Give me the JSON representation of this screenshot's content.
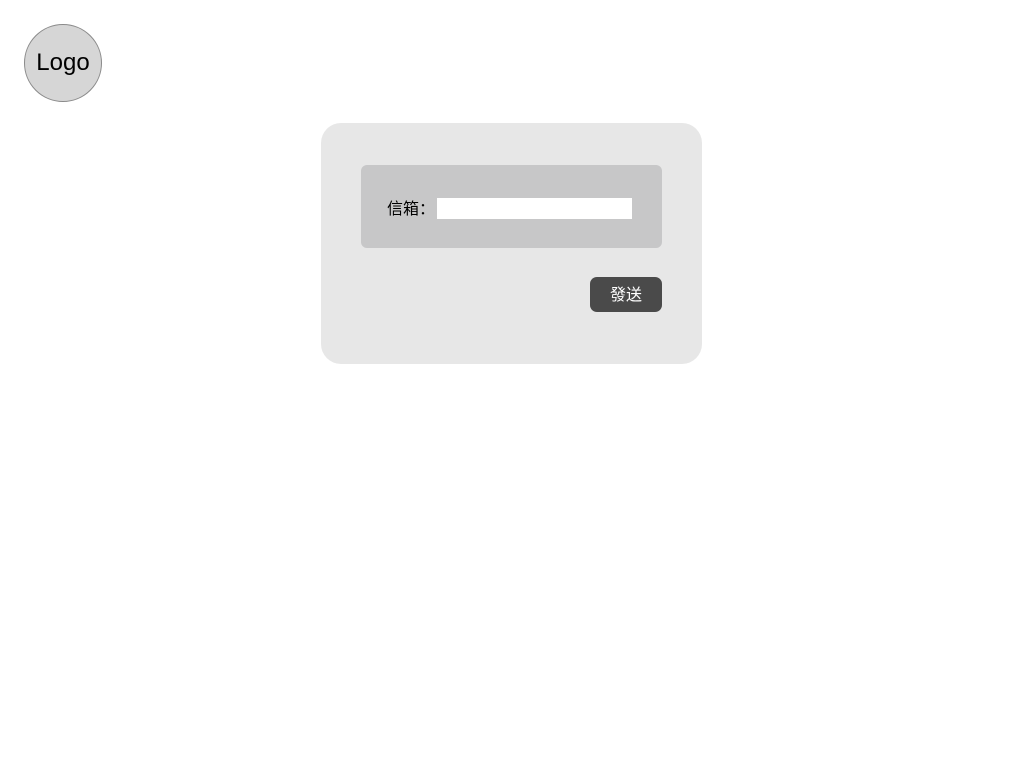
{
  "logo": {
    "text": "Logo"
  },
  "form": {
    "email_label": "信箱：",
    "email_value": "",
    "email_placeholder": "",
    "send_label": "發送"
  },
  "colors": {
    "card_background": "#e7e7e7",
    "field_group_background": "#c7c7c8",
    "button_background": "#4a4a4a",
    "logo_background": "#d6d6d6"
  }
}
